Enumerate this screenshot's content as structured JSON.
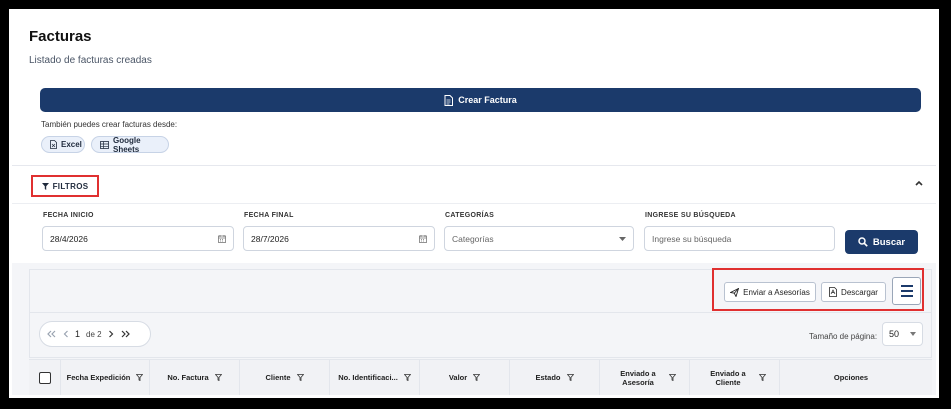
{
  "page": {
    "title": "Facturas",
    "subtitle": "Listado de facturas creadas"
  },
  "create": {
    "button_label": "Crear Factura",
    "also_text": "También puedes crear facturas desde:",
    "chips": [
      "Excel",
      "Google Sheets"
    ]
  },
  "filters": {
    "toggle_label": "FILTROS",
    "start_label": "FECHA INICIO",
    "start_value": "28/4/2026",
    "end_label": "FECHA FINAL",
    "end_value": "28/7/2026",
    "category_label": "CATEGORÍAS",
    "category_placeholder": "Categorías",
    "search_label": "INGRESE SU BÚSQUEDA",
    "search_placeholder": "Ingrese su búsqueda",
    "search_button": "Buscar"
  },
  "toolbar": {
    "send_label": "Enviar a Asesorías",
    "download_label": "Descargar"
  },
  "pagination": {
    "current_page": "1",
    "of_text": "de 2",
    "page_size_label": "Tamaño de página:",
    "page_size_value": "50"
  },
  "table": {
    "columns": [
      "Fecha Expedición",
      "No. Factura",
      "Cliente",
      "No. Identificaci...",
      "Valor",
      "Estado",
      "Enviado a Asesoría",
      "Enviado a Cliente",
      "Opciones"
    ]
  },
  "icons": {
    "accent_color": "#1b3a6b",
    "highlight_color": "#e03030"
  }
}
